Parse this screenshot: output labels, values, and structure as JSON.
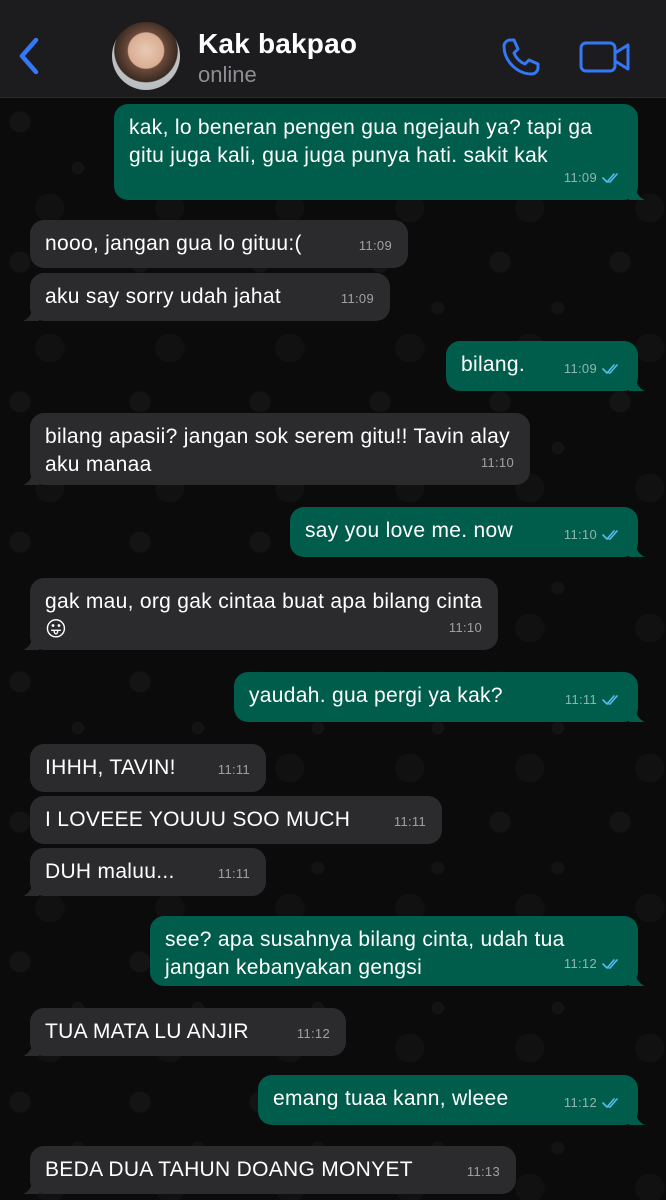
{
  "header": {
    "contact_name": "Kak bakpao",
    "status": "online"
  },
  "colors": {
    "accent": "#3478f6",
    "outgoing_bubble": "#005c4b",
    "incoming_bubble": "#2b2b2d",
    "read_ticks": "#53bdeb"
  },
  "icons": {
    "back": "chevron-left-icon",
    "call": "phone-icon",
    "video": "video-camera-icon",
    "read": "double-check-icon"
  },
  "messages": [
    {
      "dir": "out",
      "text": "kak, lo beneran pengen gua ngejauh ya? tapi ga gitu juga kali, gua juga punya hati. sakit kak",
      "time": "11:09"
    },
    {
      "dir": "in",
      "text": "nooo, jangan gua lo gituu:(",
      "time": "11:09"
    },
    {
      "dir": "in",
      "text": "aku say sorry udah jahat",
      "time": "11:09"
    },
    {
      "dir": "out",
      "text": "bilang.",
      "time": "11:09"
    },
    {
      "dir": "in",
      "text": "bilang apasii? jangan sok serem gitu!! Tavin alay aku manaa",
      "time": "11:10"
    },
    {
      "dir": "out",
      "text": "say you love me. now",
      "time": "11:10"
    },
    {
      "dir": "in",
      "text": "gak mau, org gak cintaa buat apa bilang cinta 😛",
      "time": "11:10"
    },
    {
      "dir": "out",
      "text": "yaudah. gua pergi ya kak?",
      "time": "11:11"
    },
    {
      "dir": "in",
      "text": "IHHH, TAVIN!",
      "time": "11:11"
    },
    {
      "dir": "in",
      "text": "I LOVEEE YOUUU SOO MUCH",
      "time": "11:11"
    },
    {
      "dir": "in",
      "text": "DUH maluu...",
      "time": "11:11"
    },
    {
      "dir": "out",
      "text": "see? apa susahnya bilang cinta, udah tua jangan kebanyakan gengsi",
      "time": "11:12"
    },
    {
      "dir": "in",
      "text": "TUA MATA LU ANJIR",
      "time": "11:12"
    },
    {
      "dir": "out",
      "text": "emang tuaa kann, wleee",
      "time": "11:12"
    },
    {
      "dir": "in",
      "text": "BEDA DUA TAHUN DOANG MONYET",
      "time": "11:13"
    }
  ]
}
